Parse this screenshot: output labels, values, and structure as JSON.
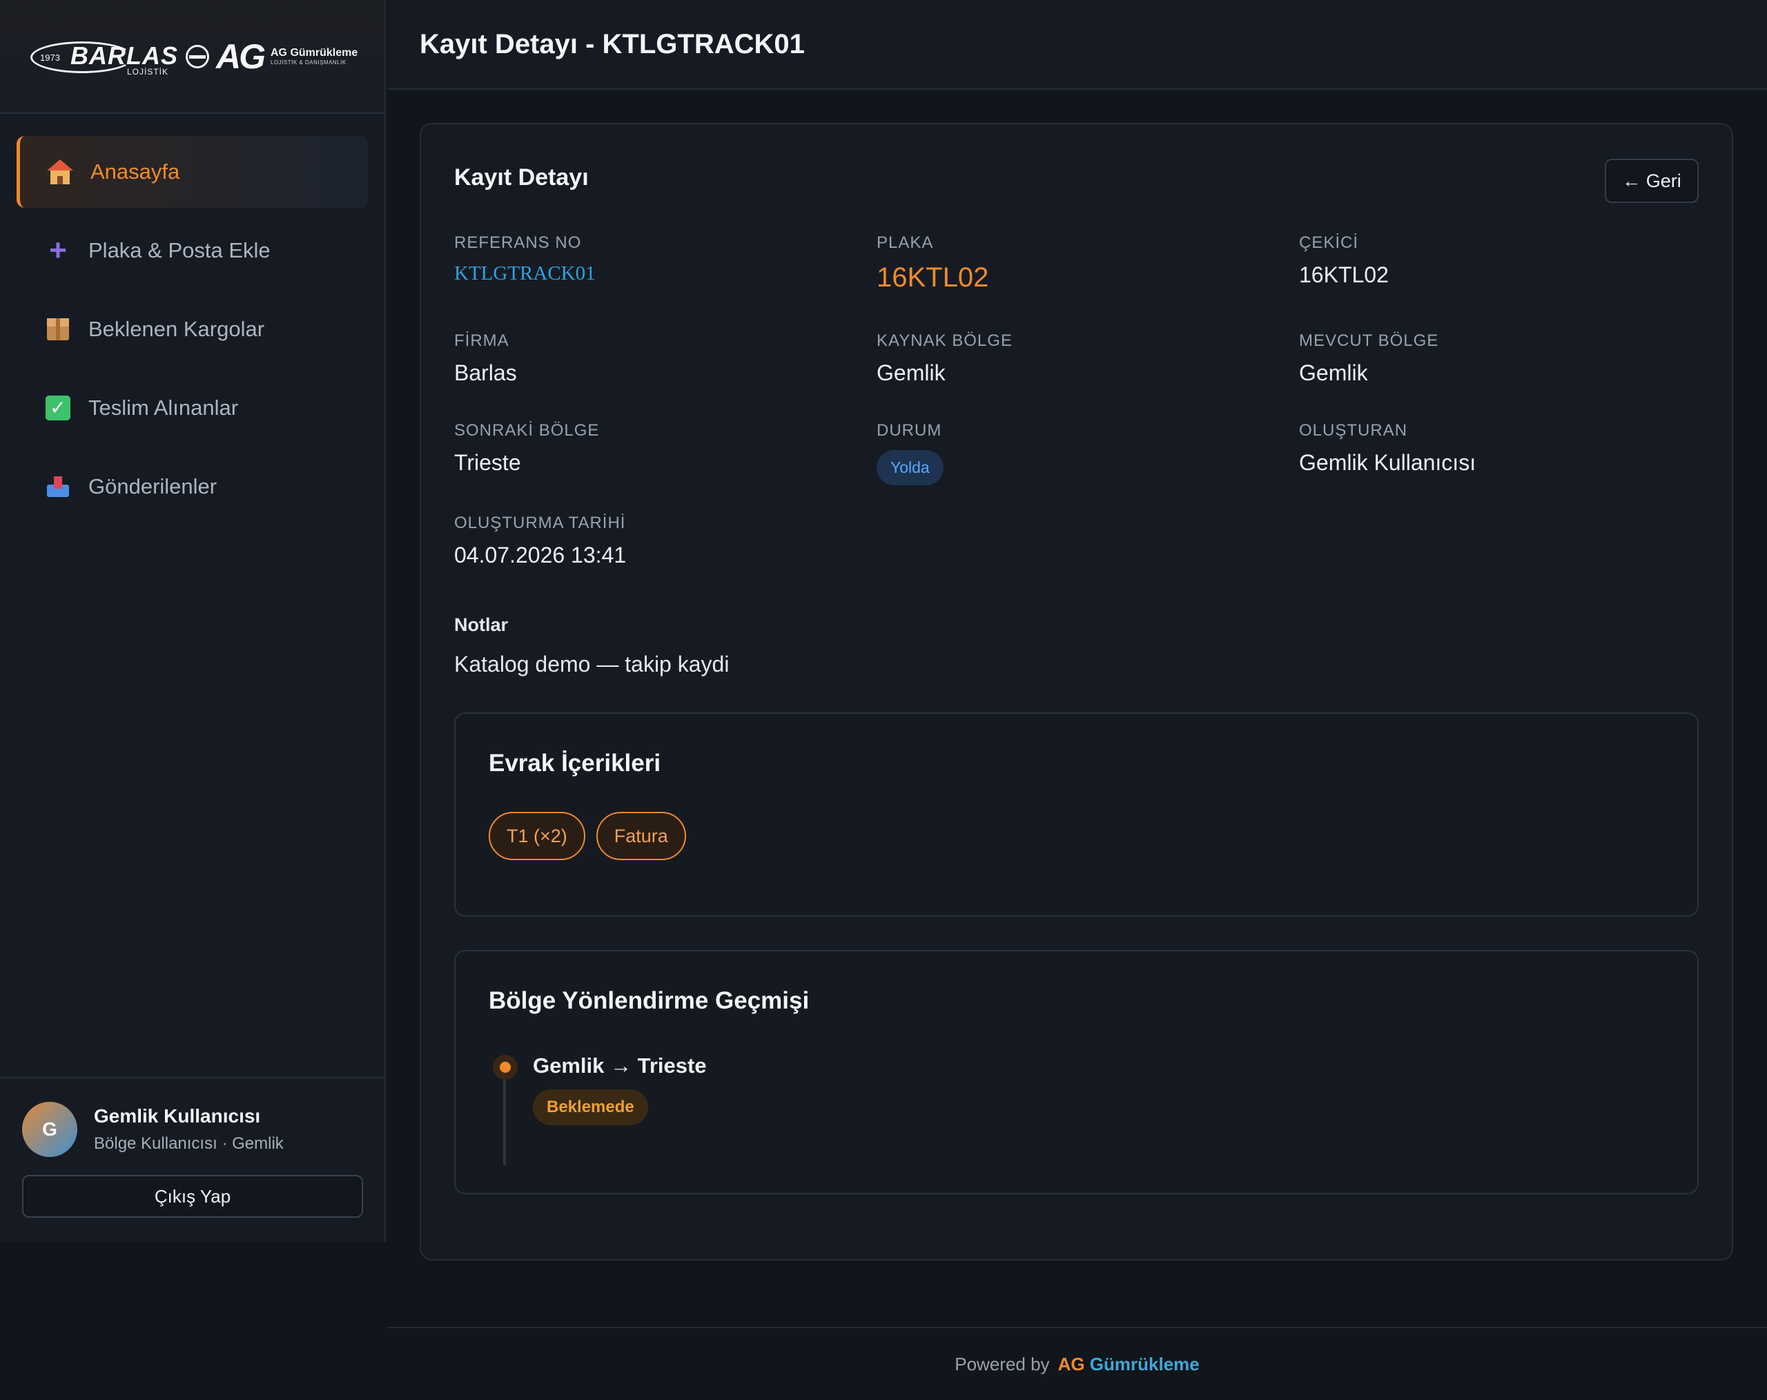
{
  "sidebar": {
    "logo": {
      "year": "1973",
      "brand": "BARLAS",
      "brand_sub": "LOJİSTİK",
      "ag": "AG",
      "ag_title": "AG Gümrükleme",
      "ag_sub": "LOJİSTİK & DANIŞMANLIK"
    },
    "items": [
      {
        "label": "Anasayfa",
        "icon": "house-icon",
        "active": true
      },
      {
        "label": "Plaka & Posta Ekle",
        "icon": "plus-icon"
      },
      {
        "label": "Beklenen Kargolar",
        "icon": "package-icon"
      },
      {
        "label": "Teslim Alınanlar",
        "icon": "check-icon"
      },
      {
        "label": "Gönderilenler",
        "icon": "outbox-icon"
      }
    ],
    "user": {
      "initial": "G",
      "name": "Gemlik Kullanıcısı",
      "role": "Bölge Kullanıcısı · Gemlik"
    },
    "logout_label": "Çıkış Yap"
  },
  "header": {
    "title": "Kayıt Detayı - KTLGTRACK01"
  },
  "detail": {
    "title": "Kayıt Detayı",
    "back_label": "← Geri",
    "fields": {
      "ref": {
        "label": "REFERANS NO",
        "value": "KTLGTRACK01"
      },
      "plate": {
        "label": "PLAKA",
        "value": "16KTL02"
      },
      "tractor": {
        "label": "ÇEKİCİ",
        "value": "16KTL02"
      },
      "firm": {
        "label": "FİRMA",
        "value": "Barlas"
      },
      "source": {
        "label": "KAYNAK BÖLGE",
        "value": "Gemlik"
      },
      "current": {
        "label": "MEVCUT BÖLGE",
        "value": "Gemlik"
      },
      "next": {
        "label": "SONRAKİ BÖLGE",
        "value": "Trieste"
      },
      "status": {
        "label": "DURUM",
        "value": "Yolda"
      },
      "creator": {
        "label": "OLUŞTURAN",
        "value": "Gemlik Kullanıcısı"
      },
      "created": {
        "label": "OLUŞTURMA TARİHİ",
        "value": "04.07.2026 13:41"
      }
    },
    "notes_label": "Notlar",
    "notes_value": "Katalog demo — takip kaydi"
  },
  "documents": {
    "title": "Evrak İçerikleri",
    "chips": [
      "T1 (×2)",
      "Fatura"
    ]
  },
  "history": {
    "title": "Bölge Yönlendirme Geçmişi",
    "entries": [
      {
        "route": "Gemlik → Trieste",
        "status": "Beklemede"
      }
    ]
  },
  "footer": {
    "prefix": "Powered by",
    "brand_a": "AG",
    "brand_b": "Gümrükleme"
  },
  "colors": {
    "accent": "#f08a2c",
    "link": "#2fa2de",
    "status_blue": "#5aa8ff",
    "pending": "#f0a030"
  }
}
